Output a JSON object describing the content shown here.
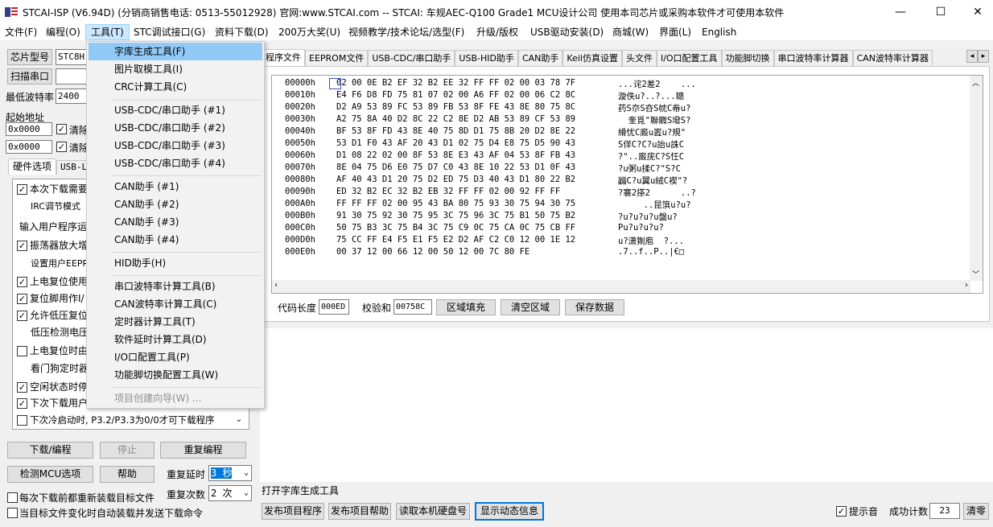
{
  "window": {
    "title": "STCAI-ISP (V6.94D) (分销商销售电话: 0513-55012928) 官网:www.STCAI.com  -- STCAI: 车规AEC-Q100 Grade1 MCU设计公司 使用本司芯片或采购本软件才可使用本软件",
    "minimize": "—",
    "maximize": "☐",
    "close": "✕"
  },
  "menubar": {
    "items": [
      "文件(F)",
      "编程(O)",
      "工具(T)",
      "STC调试接口(G)",
      "资料下载(D)",
      "200万大奖(U)",
      "视频教学/技术论坛/选型(F)",
      "升级/版权",
      "USB驱动安装(D)",
      "商城(W)",
      "界面(L)",
      "English"
    ]
  },
  "left": {
    "chip_type_btn": "芯片型号",
    "chip_value": "STC8H",
    "scan_port_btn": "扫描串口",
    "min_baud_label": "最低波特率",
    "min_baud_value": "2400",
    "start_addr_label": "起始地址",
    "addr1": "0x0000",
    "clear1": "清除",
    "addr2": "0x0000",
    "clear2": "清除",
    "tab_hw": "硬件选项",
    "tab_usb": "USB-L",
    "options": [
      "本次下载需要",
      "IRC调节模式",
      "输入用户程序运",
      "振荡器放大增",
      "设置用户EEPR",
      "上电复位使用",
      "复位脚用作I/",
      "允许低压复位",
      "低压检测电压",
      "上电复位时由",
      "看门狗定时器",
      "空闲状态时停",
      "下次下载用户",
      "下次冷启动时, P3.2/P3.3为0/0才可下载程序"
    ],
    "download_btn": "下载/编程",
    "stop_btn": "停止",
    "reprogram_btn": "重复编程",
    "detect_btn": "检测MCU选项",
    "help_btn": "帮助",
    "repeat_delay_label": "重复延时",
    "repeat_delay_value": "3 秒",
    "repeat_count_label": "重复次数",
    "repeat_count_value": "2 次",
    "reload_each": "每次下载前都重新装载目标文件",
    "auto_send": "当目标文件变化时自动装载并发送下载命令"
  },
  "tabs": [
    "程序文件",
    "EEPROM文件",
    "USB-CDC/串口助手",
    "USB-HID助手",
    "CAN助手",
    "Keil仿真设置",
    "头文件",
    "I/O口配置工具",
    "功能脚切换",
    "串口波特率计算器",
    "CAN波特率计算器"
  ],
  "tab_scroll_left": "◂",
  "tab_scroll_right": "▸",
  "hex": {
    "rows": [
      {
        "addr": "00000h",
        "bytes": "02 00 0E B2 EF 32 B2 EE 32 FF FF 02 00 03 78 7F",
        "ascii": "...诧2差2    ..."
      },
      {
        "addr": "00010h",
        "bytes": "E4 F6 D8 FD 75 81 07 02 00 A6 FF 02 00 06 C2 8C",
        "ascii": "漩佚u?..?...聰"
      },
      {
        "addr": "00020h",
        "bytes": "D2 A9 53 89 FC 53 89 FB 53 8F FE 43 8E 80 75 8C",
        "ascii": "药S夵S夻S帎C帣u?"
      },
      {
        "addr": "00030h",
        "bytes": "A2 75 8A 40 D2 8C 22 C2 8E D2 AB 53 89 CF 53 89",
        "ascii": "  奎覓\"聯覹S墢S?"
      },
      {
        "addr": "00040h",
        "bytes": "BF 53 8F FD 43 8E 40 75 8D D1 75 8B 20 D2 8E 22",
        "ascii": "縎忧C廄u嶳u?規\""
      },
      {
        "addr": "00050h",
        "bytes": "53 D1 F0 43 AF 20 43 D1 02 75 D4 E8 75 D5 90 43",
        "ascii": "S佯C?C?u詒u誅C"
      },
      {
        "addr": "00060h",
        "bytes": "D1 08 22 02 00 8F 53 8E E3 43 AF 04 53 8F FB 43",
        "ascii": "?\"..廄庑C?S忹C"
      },
      {
        "addr": "00070h",
        "bytes": "8E 04 75 D6 E0 75 D7 C0 43 8E 10 22 53 D1 0F 43",
        "ascii": "?u粥u揉C?\"S?C"
      },
      {
        "addr": "00080h",
        "bytes": "AF 40 43 D1 20 75 D2 ED 75 D3 40 43 D1 80 22 B2",
        "ascii": "疈C?u翼u絨C褉\"?"
      },
      {
        "addr": "00090h",
        "bytes": "ED 32 B2 EC 32 B2 EB 32 FF FF 02 00 92 FF FF",
        "ascii": "?褰2搽2      ..?"
      },
      {
        "addr": "000A0h",
        "bytes": "FF FF FF 02 00 95 43 BA 80 75 93 30 75 94 30 75",
        "ascii": "     ..昆篊u?u?"
      },
      {
        "addr": "000B0h",
        "bytes": "91 30 75 92 30 75 95 3C 75 96 3C 75 B1 50 75 B2",
        "ascii": "?u?u?u?u盤u?"
      },
      {
        "addr": "000C0h",
        "bytes": "50 75 B3 3C 75 B4 3C 75 C9 0C 75 CA 0C 75 CB FF",
        "ascii": "Pu?u?u?u?"
      },
      {
        "addr": "000D0h",
        "bytes": "75 CC FF E4 F5 E1 F5 E2 D2 AF C2 C0 12 00 1E 12",
        "ascii": "u?潇猘庖  ?..."
      },
      {
        "addr": "000E0h",
        "bytes": "00 37 12 00 66 12 00 50 12 00 7C 80 FE",
        "ascii": ".7..f..P..|€□"
      }
    ],
    "code_len_label": "代码长度",
    "code_len_value": "000ED",
    "checksum_label": "校验和",
    "checksum_value": "00758C",
    "fill_btn": "区域填充",
    "clear_btn": "清空区域",
    "save_btn": "保存数据"
  },
  "dropdown": {
    "items": [
      "字库生成工具(F)",
      "图片取模工具(I)",
      "CRC计算工具(C)",
      "USB-CDC/串口助手 (#1)",
      "USB-CDC/串口助手 (#2)",
      "USB-CDC/串口助手 (#3)",
      "USB-CDC/串口助手 (#4)",
      "CAN助手 (#1)",
      "CAN助手 (#2)",
      "CAN助手 (#3)",
      "CAN助手 (#4)",
      "HID助手(H)",
      "串口波特率计算工具(B)",
      "CAN波特率计算工具(C)",
      "定时器计算工具(T)",
      "软件延时计算工具(D)",
      "I/O口配置工具(P)",
      "功能脚切换配置工具(W)",
      "项目创建向导(W) ..."
    ]
  },
  "status": {
    "message": "打开字库生成工具",
    "publish_prog": "发布项目程序",
    "publish_help": "发布项目帮助",
    "read_disk": "读取本机硬盘号",
    "show_dynamic": "显示动态信息",
    "beep": "提示音",
    "success_count_label": "成功计数",
    "success_count_value": "23",
    "clear_btn": "清零"
  }
}
